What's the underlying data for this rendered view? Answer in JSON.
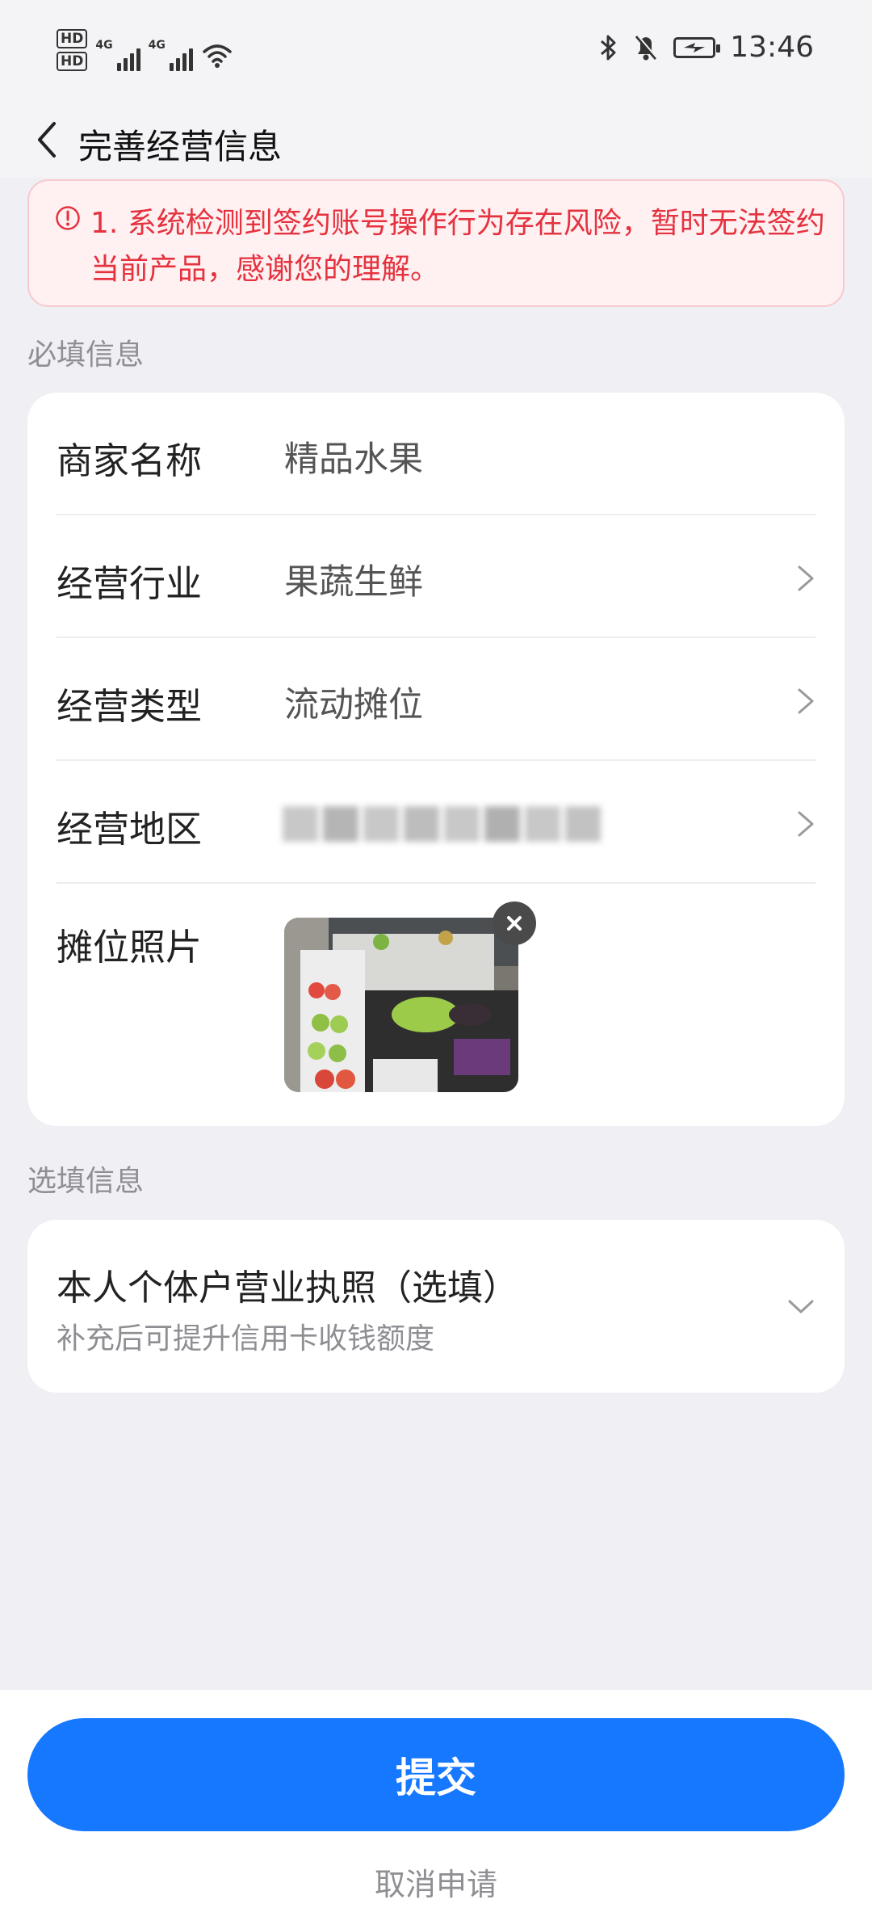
{
  "status_bar": {
    "hd1": "HD",
    "hd2": "HD",
    "net1": "4G",
    "net2": "4G",
    "time": "13:46",
    "icons": [
      "bluetooth-icon",
      "bell-off-icon",
      "battery-charging-icon",
      "wifi-icon",
      "signal-icon"
    ]
  },
  "header": {
    "title": "完善经营信息"
  },
  "warning": {
    "text": "1. 系统检测到签约账号操作行为存在风险，暂时无法签约当前产品，感谢您的理解。",
    "color": "#E5323F"
  },
  "required": {
    "section_label": "必填信息",
    "rows": [
      {
        "label": "商家名称",
        "value": "精品水果"
      },
      {
        "label": "经营行业",
        "value": "果蔬生鲜"
      },
      {
        "label": "经营类型",
        "value": "流动摊位"
      },
      {
        "label": "经营地区",
        "value": ""
      },
      {
        "label": "摊位照片"
      }
    ]
  },
  "optional": {
    "section_label": "选填信息",
    "title": "本人个体户营业执照（选填）",
    "subtitle": "补充后可提升信用卡收钱额度"
  },
  "actions": {
    "submit_label": "提交",
    "cancel_label": "取消申请",
    "accent": "#1677FF"
  }
}
